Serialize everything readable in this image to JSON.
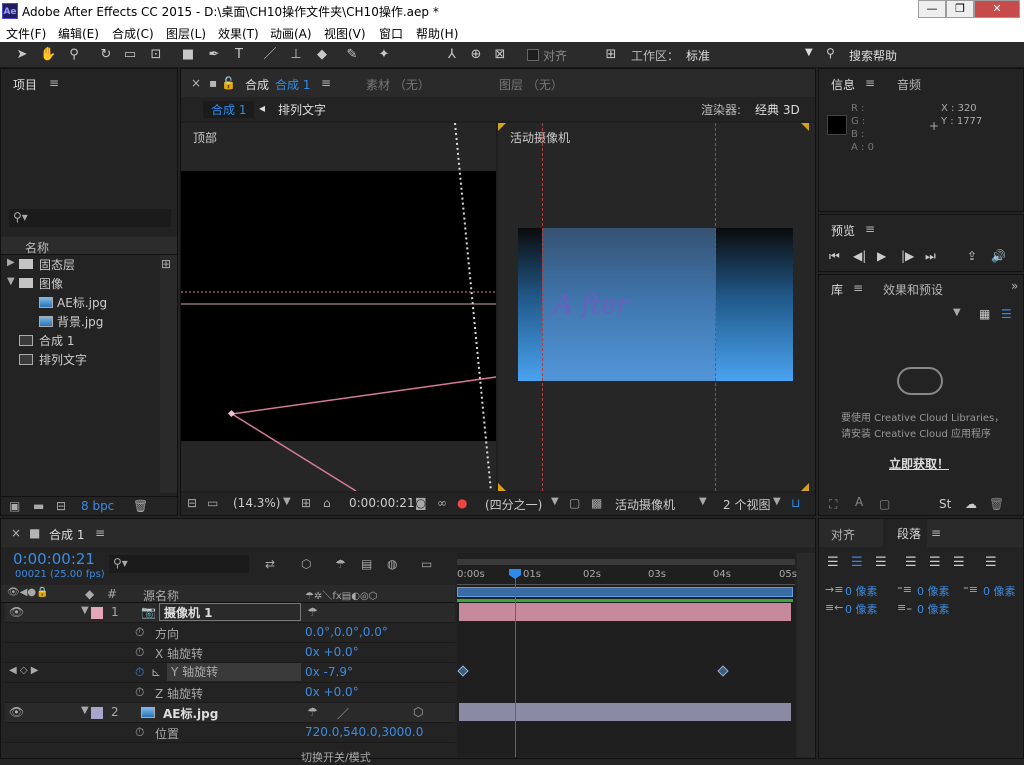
{
  "window": {
    "title": "Adobe After Effects CC 2015 - D:\\桌面\\CH10操作文件夹\\CH10操作.aep *",
    "app_badge": "Ae",
    "min": "—",
    "restore": "❐",
    "close": "✕"
  },
  "menu": [
    "文件(F)",
    "编辑(E)",
    "合成(C)",
    "图层(L)",
    "效果(T)",
    "动画(A)",
    "视图(V)",
    "窗口",
    "帮助(H)"
  ],
  "toolbar": {
    "align_label": "对齐",
    "workspace_label": "工作区：",
    "workspace_value": "标准",
    "search_help": "搜索帮助"
  },
  "project": {
    "title": "项目",
    "name_col": "名称",
    "items": [
      {
        "label": "固态层",
        "type": "folder",
        "expanded": false,
        "indent": 0
      },
      {
        "label": "图像",
        "type": "folder",
        "expanded": true,
        "indent": 0
      },
      {
        "label": "AE标.jpg",
        "type": "image",
        "indent": 1
      },
      {
        "label": "背景.jpg",
        "type": "image",
        "indent": 1
      },
      {
        "label": "合成 1",
        "type": "comp",
        "indent": 0
      },
      {
        "label": "排列文字",
        "type": "comp",
        "indent": 0
      }
    ],
    "bpc": "8 bpc"
  },
  "viewer": {
    "tab_close": "×",
    "tab_comp": "合成",
    "tab_comp_name": "合成 1",
    "footage_tab": "素材 （无）",
    "layer_tab": "图层 （无）",
    "flow_active": "合成 1",
    "flow_next": "排列文字",
    "renderer_label": "渲染器:",
    "renderer_value": "经典 3D",
    "left_view": "顶部",
    "right_view": "活动摄像机",
    "overlay_text": "A fter",
    "zoom": "(14.3%)",
    "timecode": "0:00:00:21",
    "resolution": "(四分之一)",
    "camera": "活动摄像机",
    "views": "2 个视图"
  },
  "info": {
    "title": "信息",
    "audio_tab": "音频",
    "r": "R :",
    "g": "G :",
    "b": "B :",
    "a": "A : 0",
    "x": "X : 320",
    "y": "Y : 1777"
  },
  "preview": {
    "title": "预览"
  },
  "library": {
    "title": "库",
    "effects_tab": "效果和预设",
    "msg1": "要使用 Creative Cloud Libraries，",
    "msg2": "请安装 Creative Cloud 应用程序",
    "link": "立即获取！"
  },
  "paragraph": {
    "align_tab": "对齐",
    "para_tab": "段落",
    "fields": [
      {
        "v": "0 像素"
      },
      {
        "v": "0 像素"
      },
      {
        "v": "0 像素"
      },
      {
        "v": "0 像素"
      },
      {
        "v": "0 像素"
      }
    ]
  },
  "timeline": {
    "tab_close": "×",
    "comp_name": "合成 1",
    "timecode": "0:00:00:21",
    "frames": "00021 (25.00 fps)",
    "col_num": "#",
    "col_name": "源名称",
    "ruler": [
      "0:00s",
      "01s",
      "02s",
      "03s",
      "04s",
      "05s"
    ],
    "rows": [
      {
        "num": "1",
        "name": "摄像机 1",
        "type": "layer",
        "color": "#e4a7b7"
      },
      {
        "name": "方向",
        "value": "0.0°,0.0°,0.0°"
      },
      {
        "name": "X 轴旋转",
        "value": "0x +0.0°"
      },
      {
        "name": "Y 轴旋转",
        "value": "0x -7.9°"
      },
      {
        "name": "Z 轴旋转",
        "value": "0x +0.0°"
      },
      {
        "num": "2",
        "name": "AE标.jpg",
        "type": "layer",
        "color": "#a7a7cc"
      },
      {
        "name": "位置",
        "value": "720.0,540.0,3000.0"
      }
    ],
    "footer": "切换开关/模式"
  }
}
